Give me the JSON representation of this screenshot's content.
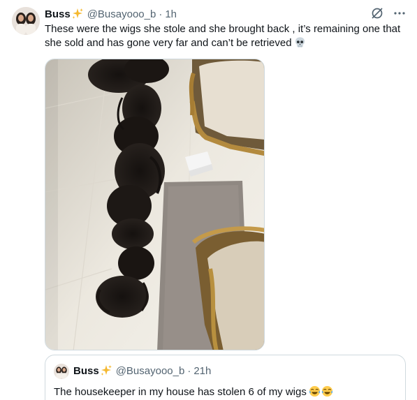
{
  "tweet": {
    "display_name": "Buss",
    "handle": "@Busayooo_b",
    "separator": "·",
    "time": "1h",
    "text": "These were the wigs she stole and she brought back , it’s remaining one that she sold and has gone very far and can’t be retrieved",
    "text_emoji": "skull-emoji",
    "verified_badge": "sparkles-emoji",
    "actions": [
      "grok-icon",
      "more-icon"
    ]
  },
  "media": {
    "icon": "photo"
  },
  "quote": {
    "display_name": "Buss",
    "handle": "@Busayooo_b",
    "separator": "·",
    "time": "21h",
    "text": "The housekeeper in my house has stolen 6 of my wigs",
    "text_emojis": [
      "face-with-tears-of-joy-emoji",
      "face-with-tears-of-joy-emoji"
    ]
  },
  "colors": {
    "text_primary": "#0f1419",
    "text_secondary": "#536471",
    "border": "#cfd9de",
    "sparkle": "#f5b82e"
  }
}
